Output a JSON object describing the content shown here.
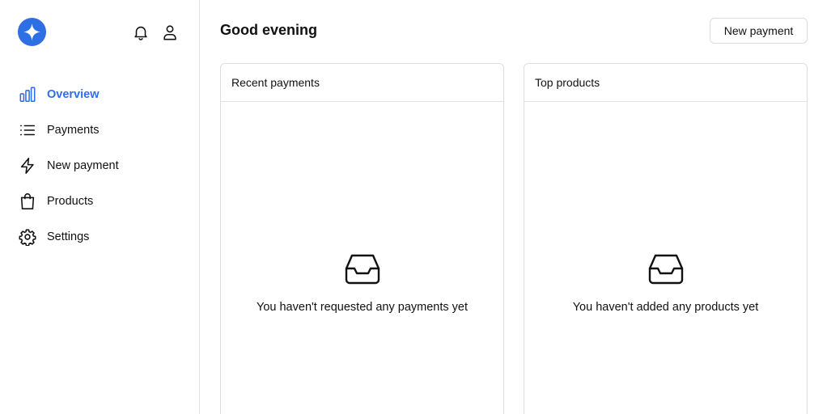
{
  "colors": {
    "accent": "#2f6fe4",
    "text": "#111111",
    "border": "#e0e0e0"
  },
  "header": {
    "logo_icon": "plus-sparkle-icon",
    "notification_icon": "bell-icon",
    "profile_icon": "user-icon"
  },
  "sidebar": {
    "items": [
      {
        "label": "Overview",
        "icon": "bar-chart-icon",
        "active": true
      },
      {
        "label": "Payments",
        "icon": "list-icon",
        "active": false
      },
      {
        "label": "New payment",
        "icon": "lightning-icon",
        "active": false
      },
      {
        "label": "Products",
        "icon": "shopping-bag-icon",
        "active": false
      },
      {
        "label": "Settings",
        "icon": "gear-icon",
        "active": false
      }
    ]
  },
  "main": {
    "greeting": "Good evening",
    "new_payment_label": "New payment",
    "cards": [
      {
        "title": "Recent payments",
        "empty_icon": "inbox-icon",
        "empty_text": "You haven't requested any payments yet"
      },
      {
        "title": "Top products",
        "empty_icon": "inbox-icon",
        "empty_text": "You haven't added any products yet"
      }
    ]
  }
}
